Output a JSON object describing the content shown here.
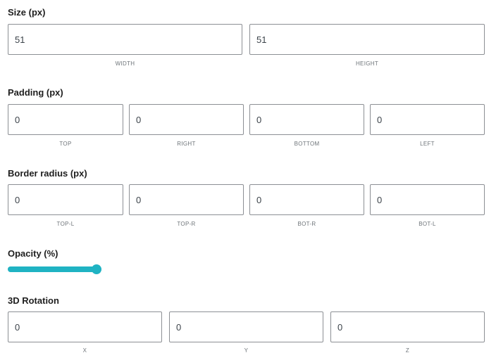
{
  "size": {
    "title": "Size (px)",
    "fields": [
      {
        "value": "51",
        "label": "WIDTH"
      },
      {
        "value": "51",
        "label": "HEIGHT"
      }
    ]
  },
  "padding": {
    "title": "Padding (px)",
    "fields": [
      {
        "value": "0",
        "label": "TOP"
      },
      {
        "value": "0",
        "label": "RIGHT"
      },
      {
        "value": "0",
        "label": "BOTTOM"
      },
      {
        "value": "0",
        "label": "LEFT"
      }
    ]
  },
  "border_radius": {
    "title": "Border radius (px)",
    "fields": [
      {
        "value": "0",
        "label": "TOP-L"
      },
      {
        "value": "0",
        "label": "TOP-R"
      },
      {
        "value": "0",
        "label": "BOT-R"
      },
      {
        "value": "0",
        "label": "BOT-L"
      }
    ]
  },
  "opacity": {
    "title": "Opacity (%)",
    "value": 100,
    "accent_color": "#1fb3c3"
  },
  "rotation": {
    "title": "3D Rotation",
    "fields": [
      {
        "value": "0",
        "label": "X"
      },
      {
        "value": "0",
        "label": "Y"
      },
      {
        "value": "0",
        "label": "Z"
      }
    ]
  }
}
